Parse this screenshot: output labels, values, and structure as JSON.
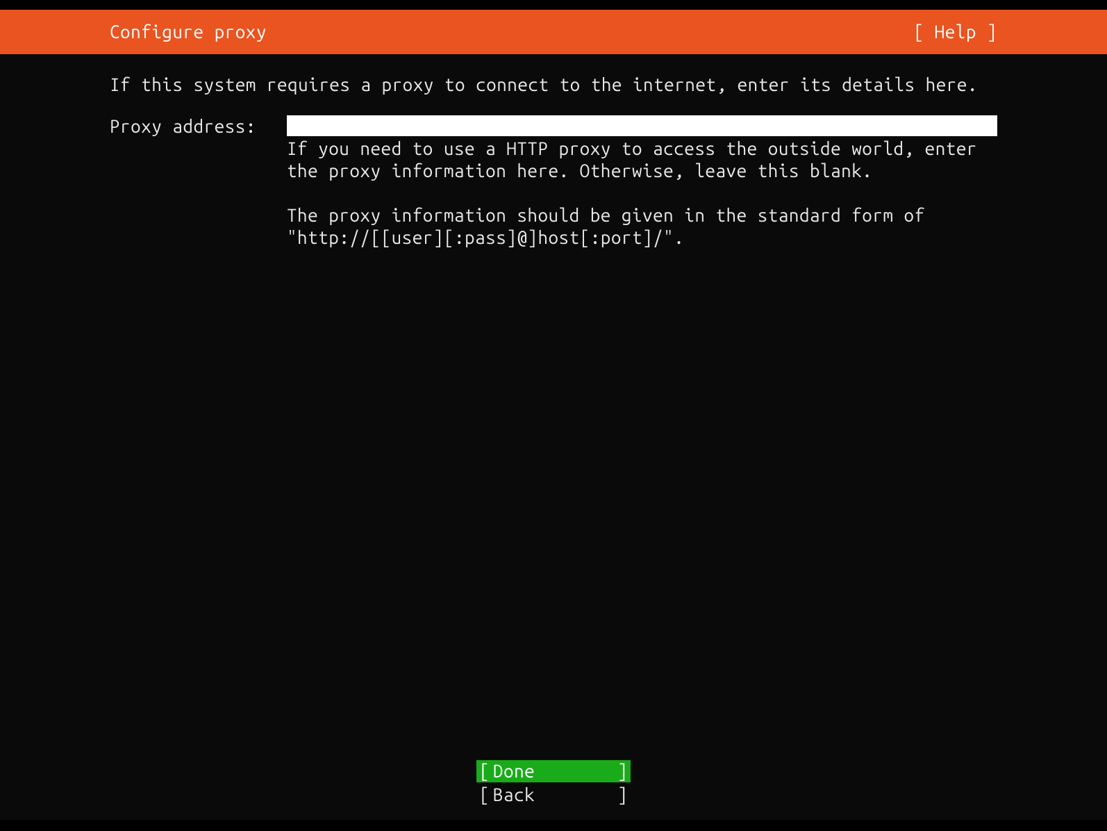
{
  "header": {
    "title": "Configure proxy",
    "help_label": "[ Help ]"
  },
  "intro_text": "If this system requires a proxy to connect to the internet, enter its details here.",
  "form": {
    "proxy_label": "Proxy address:",
    "proxy_value": "",
    "hint_line1": "If you need to use a HTTP proxy to access the outside world, enter the proxy information here. Otherwise, leave this blank.",
    "hint_line2": "The proxy information should be given in the standard form of \"http://[[user][:pass]@]host[:port]/\"."
  },
  "footer": {
    "done_label": "Done",
    "back_label": "Back",
    "bracket_l": "[",
    "bracket_r": "]"
  }
}
